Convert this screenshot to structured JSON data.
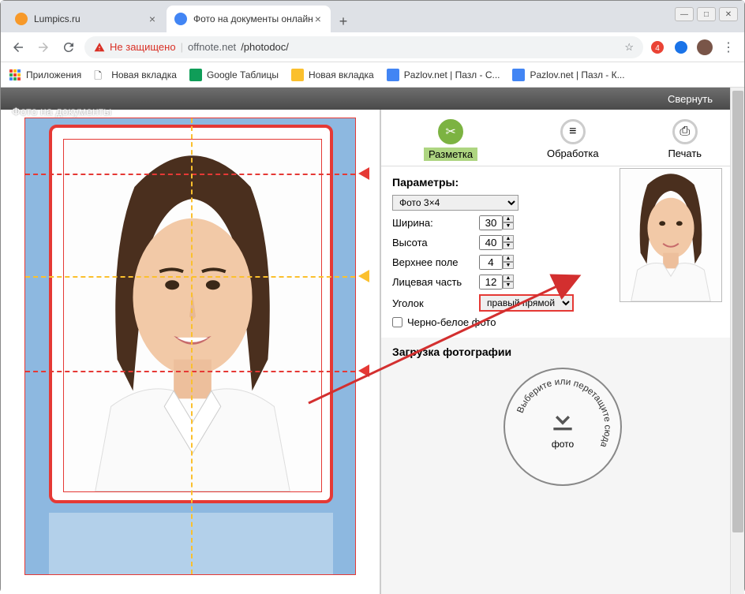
{
  "tabs": [
    {
      "title": "Lumpics.ru",
      "icon_color": "#f79929"
    },
    {
      "title": "Фото на документы онлайн",
      "icon_color": "#4285f4"
    }
  ],
  "nav": {
    "back": "←",
    "fwd": "→",
    "reload": "↻"
  },
  "address": {
    "insecure_label": "Не защищено",
    "host": "offnote.net",
    "path": "/photodoc/"
  },
  "bookmarks": [
    {
      "label": "Приложения",
      "color": "#ea4335"
    },
    {
      "label": "Новая вкладка",
      "color": "#999"
    },
    {
      "label": "Google Таблицы",
      "color": "#0f9d58"
    },
    {
      "label": "Новая вкладка",
      "color": "#fbc02d"
    },
    {
      "label": "Pazlov.net | Пазл - С...",
      "color": "#4285f4"
    },
    {
      "label": "Pazlov.net | Пазл - К...",
      "color": "#4285f4"
    }
  ],
  "topbar": {
    "collapse": "Свернуть"
  },
  "page_title": "Фото на документы",
  "steps": [
    {
      "label": "Разметка",
      "icon": "⬚"
    },
    {
      "label": "Обработка",
      "icon": "⚙"
    },
    {
      "label": "Печать",
      "icon": "🖨"
    }
  ],
  "params": {
    "heading": "Параметры:",
    "format_options": [
      "Фото 3×4"
    ],
    "format_selected": "Фото 3×4",
    "width_label": "Ширина:",
    "width_value": "30",
    "height_label": "Высота",
    "height_value": "40",
    "top_label": "Верхнее поле",
    "top_value": "4",
    "face_label": "Лицевая часть",
    "face_value": "12",
    "corner_label": "Уголок",
    "corner_selected": "правый прямой",
    "bw_label": "Черно-белое фото"
  },
  "upload": {
    "heading": "Загрузка фотографии",
    "circle_text": "Выберите или перетащите сюда",
    "photo_label": "фото"
  }
}
